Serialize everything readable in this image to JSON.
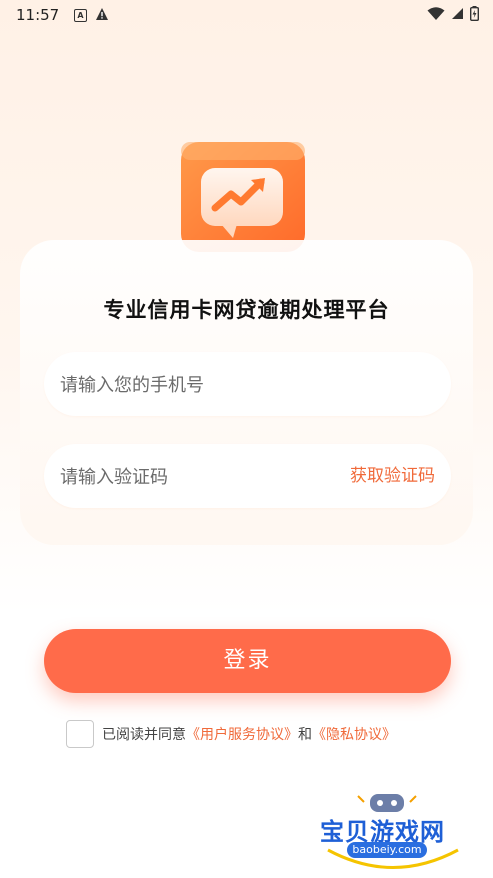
{
  "status_bar": {
    "time": "11:57",
    "icons": [
      "a-box-icon",
      "warning-icon",
      "wifi-icon",
      "signal-icon",
      "battery-icon"
    ]
  },
  "hero": {
    "icon": "chart-trend-icon"
  },
  "card": {
    "title": "专业信用卡网贷逾期处理平台",
    "phone_placeholder": "请输入您的手机号",
    "code_placeholder": "请输入验证码",
    "get_code_label": "获取验证码"
  },
  "login_button": "登录",
  "agreement": {
    "prefix": "已阅读并同意",
    "user_agreement": "《用户服务协议》",
    "and": "和",
    "privacy_policy": "《隐私协议》"
  },
  "watermark": {
    "title": "宝贝游戏网",
    "url": "baobeiy.com"
  },
  "colors": {
    "accent": "#ff6b4a",
    "link": "#f06a3a",
    "background_top": "#fff1e6"
  }
}
